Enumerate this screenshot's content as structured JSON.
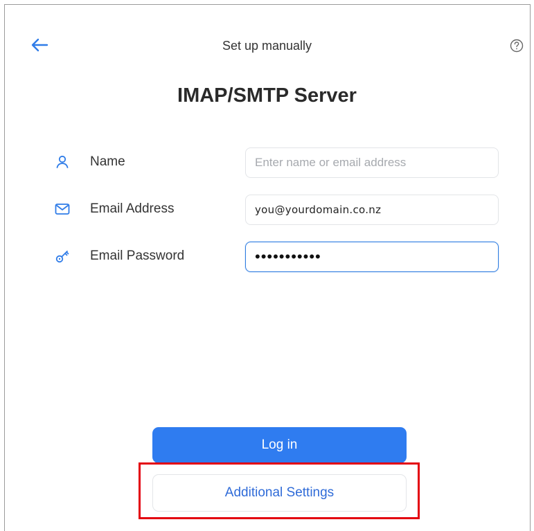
{
  "header": {
    "title": "Set up manually",
    "back_icon": "back-arrow-icon",
    "help_icon": "help-icon"
  },
  "main": {
    "title": "IMAP/SMTP Server"
  },
  "form": {
    "name": {
      "label": "Name",
      "icon": "person-icon",
      "placeholder": "Enter name or email address",
      "value": ""
    },
    "email": {
      "label": "Email Address",
      "icon": "envelope-icon",
      "value": "you@yourdomain.co.nz"
    },
    "password": {
      "label": "Email Password",
      "icon": "key-icon",
      "value": "•••••••••••"
    }
  },
  "buttons": {
    "login": "Log in",
    "additional": "Additional Settings"
  },
  "colors": {
    "accent": "#2f7cf0",
    "highlight": "#e3000f",
    "link": "#2f6bd8"
  }
}
